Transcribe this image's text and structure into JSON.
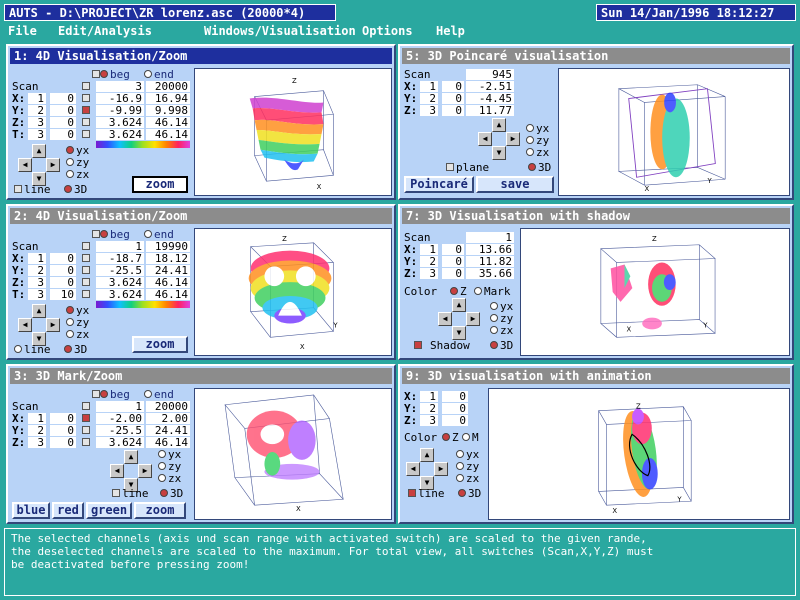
{
  "window": {
    "title": "AUTS - D:\\PROJECT\\ZR lorenz.asc (20000*4)",
    "clock": "Sun 14/Jan/1996 18:12:27"
  },
  "menu": [
    "File",
    "Edit/Analysis",
    "Windows/Visualisation",
    "Options",
    "Help"
  ],
  "common": {
    "scan": "Scan",
    "beg": "beg",
    "end": "end",
    "x": "X:",
    "y": "Y:",
    "z": "Z:",
    "t": "T:",
    "yx": "yx",
    "zy": "zy",
    "zx": "zx",
    "line": "line",
    "threed": "3D"
  },
  "panel1": {
    "title": "1: 4D Visualisation/Zoom",
    "rows": [
      {
        "ch": "1",
        "off": "0",
        "beg": "-16.9",
        "end": "16.94"
      },
      {
        "ch": "2",
        "off": "0",
        "beg": "-9.99",
        "end": "9.998"
      },
      {
        "ch": "3",
        "off": "0",
        "beg": "3.624",
        "end": "46.14"
      },
      {
        "ch": "3",
        "off": "0",
        "beg": "3.624",
        "end": "46.14"
      }
    ],
    "scan_beg": "3",
    "scan_end": "20000",
    "zoom": "zoom"
  },
  "panel2": {
    "title": "2: 4D Visualisation/Zoom",
    "rows": [
      {
        "ch": "1",
        "off": "0",
        "beg": "-18.7",
        "end": "18.12"
      },
      {
        "ch": "2",
        "off": "0",
        "beg": "-25.5",
        "end": "24.41"
      },
      {
        "ch": "3",
        "off": "0",
        "beg": "3.624",
        "end": "46.14"
      },
      {
        "ch": "3",
        "off": "10",
        "beg": "3.624",
        "end": "46.14"
      }
    ],
    "scan_beg": "1",
    "scan_end": "19990",
    "zoom": "zoom"
  },
  "panel3": {
    "title": "3: 3D Mark/Zoom",
    "rows": [
      {
        "ch": "1",
        "off": "0",
        "beg": "-2.00",
        "end": "2.00"
      },
      {
        "ch": "2",
        "off": "0",
        "beg": "-25.5",
        "end": "24.41"
      },
      {
        "ch": "3",
        "off": "0",
        "beg": "3.624",
        "end": "46.14"
      }
    ],
    "scan_beg": "1",
    "scan_end": "20000",
    "buttons": [
      "blue",
      "red",
      "green",
      "zoom"
    ]
  },
  "panel5": {
    "title": "5: 3D Poincaré visualisation",
    "scan_val": "945",
    "rows": [
      {
        "ch": "1",
        "off": "0",
        "val": "-2.51"
      },
      {
        "ch": "2",
        "off": "0",
        "val": "-4.45"
      },
      {
        "ch": "3",
        "off": "0",
        "val": "11.77"
      }
    ],
    "plane": "plane",
    "poincare": "Poincaré",
    "save": "save"
  },
  "panel7": {
    "title": "7: 3D Visualisation with shadow",
    "scan_val": "1",
    "rows": [
      {
        "ch": "1",
        "off": "0",
        "val": "13.66"
      },
      {
        "ch": "2",
        "off": "0",
        "val": "11.82"
      },
      {
        "ch": "3",
        "off": "0",
        "val": "35.66"
      }
    ],
    "color": "Color",
    "z": "Z",
    "mark": "Mark",
    "shadow": "Shadow"
  },
  "panel9": {
    "title": "9: 3D visualisation with animation",
    "rows": [
      {
        "ch": "1",
        "off": "0"
      },
      {
        "ch": "2",
        "off": "0"
      },
      {
        "ch": "3",
        "off": "0"
      }
    ],
    "color": "Color",
    "z": "Z",
    "m": "M"
  },
  "status": {
    "line1": "The selected channels (axis und scan range with activated switch) are scaled to the given rande,",
    "line2": "the deselected channels are scaled to the maximum. For total view, all switches (Scan,X,Y,Z) must",
    "line3": "be deactivated before pressing zoom!"
  },
  "axis_labels": {
    "x": "X",
    "y": "Y",
    "z": "Z"
  }
}
